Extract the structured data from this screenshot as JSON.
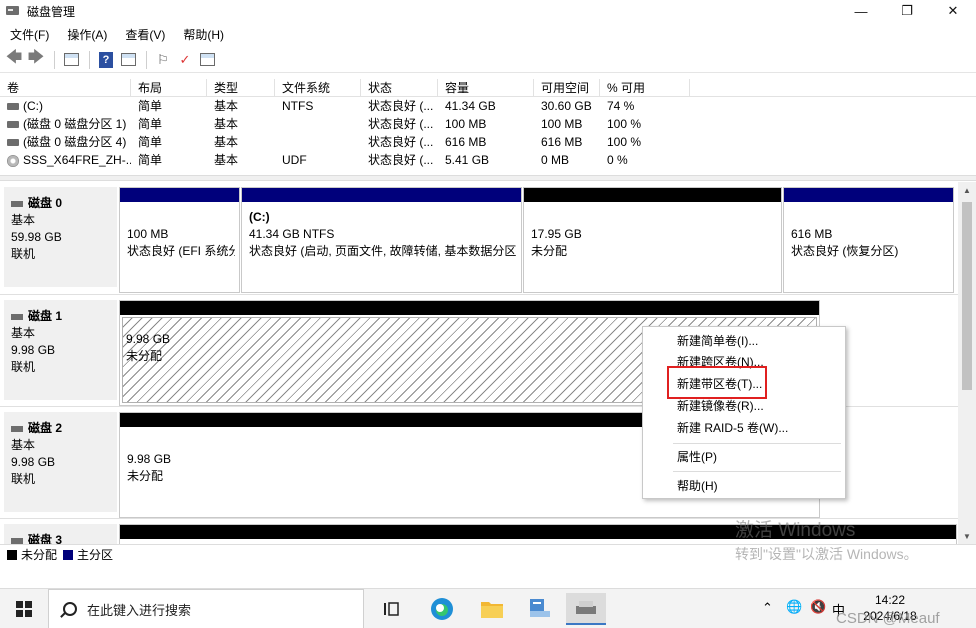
{
  "window": {
    "title": "磁盘管理",
    "min": "—",
    "max": "❐",
    "close": "✕"
  },
  "menu": [
    "文件(F)",
    "操作(A)",
    "查看(V)",
    "帮助(H)"
  ],
  "volume_list": {
    "headers": [
      "卷",
      "布局",
      "类型",
      "文件系统",
      "状态",
      "容量",
      "可用空间",
      "% 可用"
    ],
    "rows": [
      [
        "(C:)",
        "简单",
        "基本",
        "NTFS",
        "状态良好 (...",
        "41.34 GB",
        "30.60 GB",
        "74 %"
      ],
      [
        "(磁盘 0 磁盘分区 1)",
        "简单",
        "基本",
        "",
        "状态良好 (...",
        "100 MB",
        "100 MB",
        "100 %"
      ],
      [
        "(磁盘 0 磁盘分区 4)",
        "简单",
        "基本",
        "",
        "状态良好 (...",
        "616 MB",
        "616 MB",
        "100 %"
      ],
      [
        "SSS_X64FRE_ZH-...",
        "简单",
        "基本",
        "UDF",
        "状态良好 (...",
        "5.41 GB",
        "0 MB",
        "0 %"
      ]
    ]
  },
  "disks": [
    {
      "name": "磁盘 0",
      "type": "基本",
      "size": "59.98 GB",
      "status": "联机",
      "partitions": [
        {
          "title": "",
          "size": "100 MB",
          "status": "状态良好 (EFI 系统分",
          "bar": "blue"
        },
        {
          "title": "(C:)",
          "size": "41.34 GB NTFS",
          "status": "状态良好 (启动, 页面文件, 故障转储, 基本数据分区",
          "bar": "blue"
        },
        {
          "title": "",
          "size": "17.95 GB",
          "status": "未分配",
          "bar": "black"
        },
        {
          "title": "",
          "size": "616 MB",
          "status": "状态良好 (恢复分区)",
          "bar": "blue"
        }
      ]
    },
    {
      "name": "磁盘 1",
      "type": "基本",
      "size": "9.98 GB",
      "status": "联机",
      "partitions": [
        {
          "size": "9.98 GB",
          "status": "未分配"
        }
      ]
    },
    {
      "name": "磁盘 2",
      "type": "基本",
      "size": "9.98 GB",
      "status": "联机",
      "partitions": [
        {
          "size": "9.98 GB",
          "status": "未分配"
        }
      ]
    },
    {
      "name": "磁盘 3"
    }
  ],
  "legend": {
    "unallocated": "未分配",
    "primary": "主分区",
    "unallocated_color": "#000000",
    "primary_color": "#00007b"
  },
  "context_menu": {
    "items": [
      "新建简单卷(I)...",
      "新建跨区卷(N)...",
      "新建带区卷(T)...",
      "新建镜像卷(R)...",
      "新建 RAID-5 卷(W)...",
      "属性(P)",
      "帮助(H)"
    ],
    "highlighted": "新建带区卷(T)..."
  },
  "watermark": {
    "line1": "激活 Windows",
    "line2": "转到\"设置\"以激活 Windows。"
  },
  "taskbar": {
    "search_placeholder": "在此键入进行搜索",
    "time": "14:22",
    "date": "2024/6/18",
    "ime": "中",
    "overlay": "CSDN @Meauf"
  }
}
